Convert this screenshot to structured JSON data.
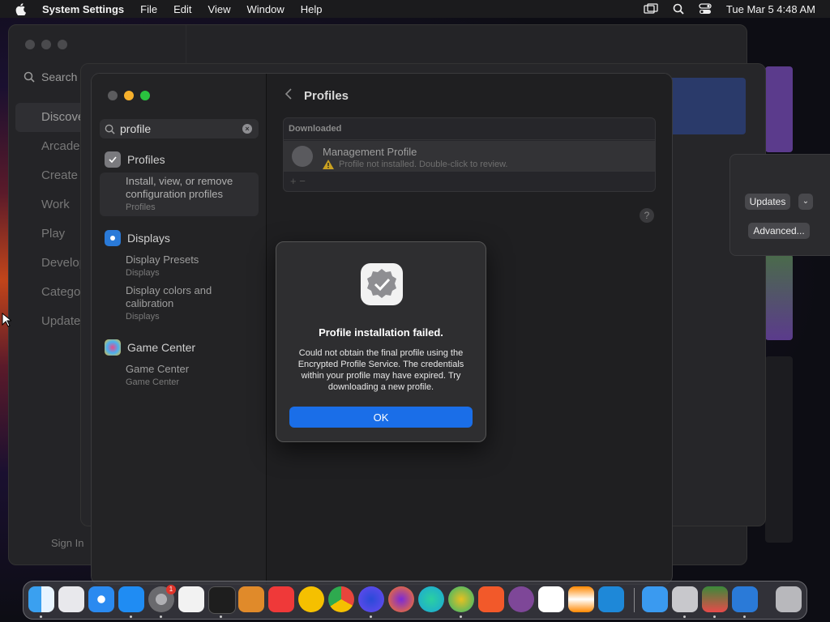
{
  "menubar": {
    "app_name": "System Settings",
    "menus": [
      "File",
      "Edit",
      "View",
      "Window",
      "Help"
    ],
    "clock": "Tue Mar 5  4:48 AM"
  },
  "background_window": {
    "search_placeholder": "Search",
    "sidebar_items": [
      "Discover",
      "Arcade",
      "Create",
      "Work",
      "Play",
      "Develop",
      "Categories",
      "Updates"
    ],
    "sign_in": "Sign In",
    "updates_button": "Updates",
    "advanced_button": "Advanced..."
  },
  "sidebar": {
    "search_value": "profile",
    "sections": [
      {
        "label": "Profiles",
        "results": [
          {
            "title": "Install, view, or remove configuration profiles",
            "sub": "Profiles"
          }
        ]
      },
      {
        "label": "Displays",
        "results": [
          {
            "title": "Display Presets",
            "sub": "Displays"
          },
          {
            "title": "Display colors and calibration",
            "sub": "Displays"
          }
        ]
      },
      {
        "label": "Game Center",
        "results": [
          {
            "title": "Game Center",
            "sub": "Game Center"
          }
        ]
      }
    ]
  },
  "content": {
    "title": "Profiles",
    "list_header": "Downloaded",
    "profile_name": "Management Profile",
    "profile_status": "Profile not installed. Double-click to review.",
    "add_remove": "+  −",
    "help": "?"
  },
  "alert": {
    "title": "Profile installation failed.",
    "message": "Could not obtain the final profile using the Encrypted Profile Service. The credentials within your profile may have expired. Try downloading a new profile.",
    "ok_label": "OK"
  },
  "dock": {
    "apps": [
      "Finder",
      "Launchpad",
      "Safari",
      "App Store",
      "System Settings",
      "TextEdit",
      "Terminal",
      "GarageBand",
      "Vivaldi",
      "Chrome Canary",
      "Google Chrome",
      "Firefox Nightly",
      "Firefox",
      "Microsoft Edge",
      "Microsoft Edge Canary",
      "Brave",
      "Tor Browser",
      "CapCut",
      "VLC",
      "Visual Studio Code",
      "Preview",
      "System Information",
      "Disk Utility",
      "Remote Desktop",
      "Trash"
    ],
    "system_settings_badge": "1",
    "colors": {
      "finder": "#3aa0f0",
      "launchpad": "#e8e8ec",
      "safari": "#2a8af0",
      "appstore": "#1f8cf3",
      "settings": "#8a8a8e",
      "textedit": "#f2f2f2",
      "terminal": "#1e1e1e",
      "garageband": "#e08a2a",
      "vivaldi": "#ef3939",
      "chromecanary": "#f5c000",
      "chrome": "#e8453c",
      "firefoxnightly": "#6a4af0",
      "firefox": "#ff7a1a",
      "edge": "#1ba6d8",
      "edgecanary": "#2bb673",
      "brave": "#f2592a",
      "tor": "#7e4798",
      "capcut": "#ffffff",
      "vlc": "#ff8800",
      "vscode": "#1e88d8",
      "preview": "#3a9af0",
      "sysinfo": "#c8c8cc",
      "diskutil": "#3a8a3a",
      "remotedesktop": "#2a7ad8",
      "trash": "#b8b8bc"
    }
  }
}
